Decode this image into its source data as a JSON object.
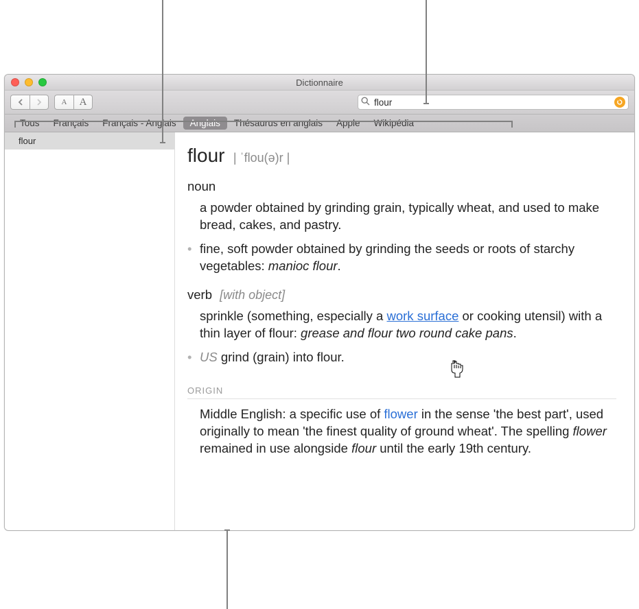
{
  "window": {
    "title": "Dictionnaire"
  },
  "toolbar": {
    "font_small": "A",
    "font_big": "A"
  },
  "search": {
    "value": "flour",
    "placeholder": ""
  },
  "sources": {
    "items": [
      {
        "label": "Tous",
        "selected": false
      },
      {
        "label": "Français",
        "selected": false
      },
      {
        "label": "Français - Anglais",
        "selected": false
      },
      {
        "label": "Anglais",
        "selected": true
      },
      {
        "label": "Thésaurus en anglais",
        "selected": false
      },
      {
        "label": "Apple",
        "selected": false
      },
      {
        "label": "Wikipédia",
        "selected": false
      }
    ]
  },
  "sidebar": {
    "items": [
      {
        "label": "flour",
        "selected": true
      }
    ]
  },
  "entry": {
    "headword": "flour",
    "pronunciation": "| ˈflou(ə)r |",
    "noun_label": "noun",
    "noun_def": "a powder obtained by grinding grain, typically wheat, and used to make bread, cakes, and pastry.",
    "noun_sub_pre": "fine, soft powder obtained by grinding the seeds or roots of starchy vegetables: ",
    "noun_sub_example": "manioc flour",
    "noun_sub_post": ".",
    "verb_label": "verb",
    "verb_note": "[with object]",
    "verb_def_pre": "sprinkle (something, especially a ",
    "verb_def_link": "work surface",
    "verb_def_mid": " or cooking utensil) with a thin layer of flour: ",
    "verb_def_example": "grease and flour two round cake pans",
    "verb_def_post": ".",
    "verb_sub_region": "US",
    "verb_sub_text": " grind (grain) into flour.",
    "origin_label": "ORIGIN",
    "origin_pre": "Middle English: a specific use of ",
    "origin_link": "flower",
    "origin_mid1": " in the sense 'the best part', used originally to mean 'the finest quality of ground wheat'. The spelling ",
    "origin_ital1": "flower",
    "origin_mid2": " remained in use alongside ",
    "origin_ital2": "flour",
    "origin_post": " until the early 19th century."
  }
}
